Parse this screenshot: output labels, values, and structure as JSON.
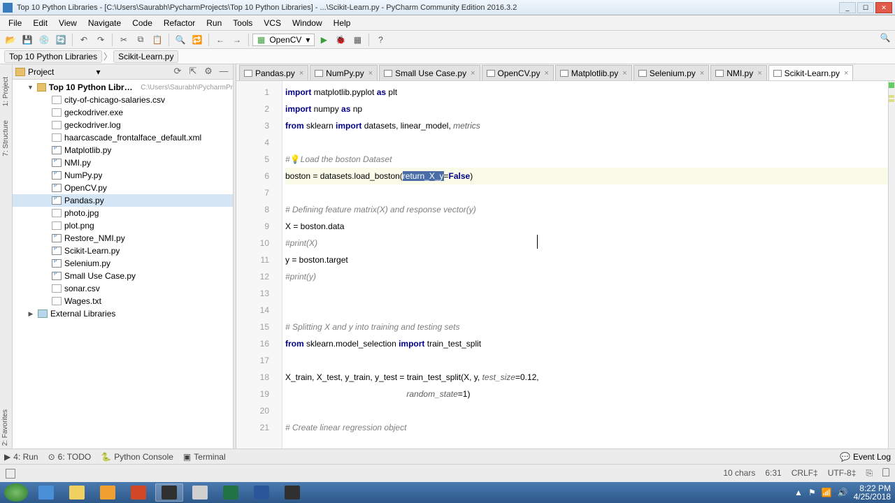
{
  "window": {
    "title": "Top 10 Python Libraries - [C:\\Users\\Saurabh\\PycharmProjects\\Top 10 Python Libraries] - ...\\Scikit-Learn.py - PyCharm Community Edition 2016.3.2",
    "minimize": "_",
    "maximize": "☐",
    "close": "✕"
  },
  "menu": [
    "File",
    "Edit",
    "View",
    "Navigate",
    "Code",
    "Refactor",
    "Run",
    "Tools",
    "VCS",
    "Window",
    "Help"
  ],
  "toolbar": {
    "config": "OpenCV",
    "icons": {
      "open": "📂",
      "save": "💾",
      "saveall": "💿",
      "refresh": "🔄",
      "undo": "↶",
      "redo": "↷",
      "cut": "✂",
      "copy": "⧉",
      "paste": "📋",
      "find": "🔍",
      "replace": "🔁",
      "back": "←",
      "fwd": "→",
      "run": "▶",
      "debug": "🐞",
      "coverage": "▦",
      "stop": "◼",
      "help": "?",
      "search": "🔍"
    }
  },
  "crumbs": {
    "root": "Top 10 Python Libraries",
    "file": "Scikit-Learn.py"
  },
  "gutter_tabs": [
    "1: Project",
    "7: Structure",
    "2: Favorites"
  ],
  "panel": {
    "title": "Project",
    "btns": {
      "sync": "⟳",
      "collapse": "⇱",
      "gear": "⚙",
      "hide": "—"
    }
  },
  "tree": {
    "root": {
      "name": "Top 10 Python Libraries",
      "hint": "C:\\Users\\Saurabh\\PycharmPr"
    },
    "files": [
      "city-of-chicago-salaries.csv",
      "geckodriver.exe",
      "geckodriver.log",
      "haarcascade_frontalface_default.xml",
      "Matplotlib.py",
      "NMI.py",
      "NumPy.py",
      "OpenCV.py",
      "Pandas.py",
      "photo.jpg",
      "plot.png",
      "Restore_NMI.py",
      "Scikit-Learn.py",
      "Selenium.py",
      "Small Use Case.py",
      "sonar.csv",
      "Wages.txt"
    ],
    "ext": "External Libraries"
  },
  "tabs": [
    {
      "name": "Pandas.py"
    },
    {
      "name": "NumPy.py"
    },
    {
      "name": "Small Use Case.py"
    },
    {
      "name": "OpenCV.py"
    },
    {
      "name": "Matplotlib.py"
    },
    {
      "name": "Selenium.py"
    },
    {
      "name": "NMI.py"
    },
    {
      "name": "Scikit-Learn.py",
      "active": true
    }
  ],
  "code": {
    "selected": "return_X_y",
    "lines": [
      {
        "n": 1,
        "html": "<span class='kw'>import</span> matplotlib.pyplot <span class='kw'>as</span> plt"
      },
      {
        "n": 2,
        "html": "<span class='kw'>import</span> numpy <span class='kw'>as</span> np"
      },
      {
        "n": 3,
        "html": "<span class='kw'>from</span> sklearn <span class='kw'>import</span> datasets, linear_model, <span class='param'>metrics</span>"
      },
      {
        "n": 4,
        "html": ""
      },
      {
        "n": 5,
        "html": "<span class='com'>#<span class='bulb'>💡</span>Load the boston Dataset</span>"
      },
      {
        "n": 6,
        "hl": true,
        "html": "boston = datasets.load_boston(<span class='sel'>return_X_y</span>=<span class='kw'>False</span>)"
      },
      {
        "n": 7,
        "html": ""
      },
      {
        "n": 8,
        "html": "<span class='com'># Defining feature matrix(X) and response vector(y)</span>"
      },
      {
        "n": 9,
        "html": "X = boston.data"
      },
      {
        "n": 10,
        "html": "<span class='com'>#print(X)</span>"
      },
      {
        "n": 11,
        "html": "y = boston.target"
      },
      {
        "n": 12,
        "html": "<span class='com'>#print(y)</span>"
      },
      {
        "n": 13,
        "html": ""
      },
      {
        "n": 14,
        "html": ""
      },
      {
        "n": 15,
        "html": "<span class='com'># Splitting X and y into training and testing sets</span>"
      },
      {
        "n": 16,
        "html": "<span class='kw'>from</span> sklearn.model_selection <span class='kw'>import</span> train_test_split"
      },
      {
        "n": 17,
        "html": ""
      },
      {
        "n": 18,
        "html": "X_train, X_test, y_train, y_test = train_test_split(X, y, <span class='param'>test_size</span>=0.12,"
      },
      {
        "n": 19,
        "html": "                                                    <span class='param'>random_state</span>=1)"
      },
      {
        "n": 20,
        "html": ""
      },
      {
        "n": 21,
        "html": "<span class='com'># Create linear regression object</span>"
      }
    ]
  },
  "bottom_tabs": [
    {
      "icon": "▶",
      "label": "4: Run"
    },
    {
      "icon": "⊙",
      "label": "6: TODO"
    },
    {
      "icon": "🐍",
      "label": "Python Console"
    },
    {
      "icon": "▣",
      "label": "Terminal"
    }
  ],
  "event_log": {
    "icon": "💬",
    "label": "Event Log"
  },
  "status": {
    "chars": "10 chars",
    "pos": "6:31",
    "sep": "CRLF‡",
    "enc": "UTF-8‡",
    "ctx": "⎘"
  },
  "taskbar_apps": [
    {
      "name": "ie",
      "color": "#4a90d9"
    },
    {
      "name": "explorer",
      "color": "#f0d060"
    },
    {
      "name": "wmp",
      "color": "#f0a030"
    },
    {
      "name": "pp",
      "color": "#d24726"
    },
    {
      "name": "pycharm",
      "color": "#303030",
      "active": true
    },
    {
      "name": "calc",
      "color": "#d0d0d0"
    },
    {
      "name": "excel",
      "color": "#217346"
    },
    {
      "name": "word",
      "color": "#2b579a"
    },
    {
      "name": "obs",
      "color": "#303030"
    }
  ],
  "clock": {
    "time": "8:22 PM",
    "date": "4/25/2018"
  }
}
